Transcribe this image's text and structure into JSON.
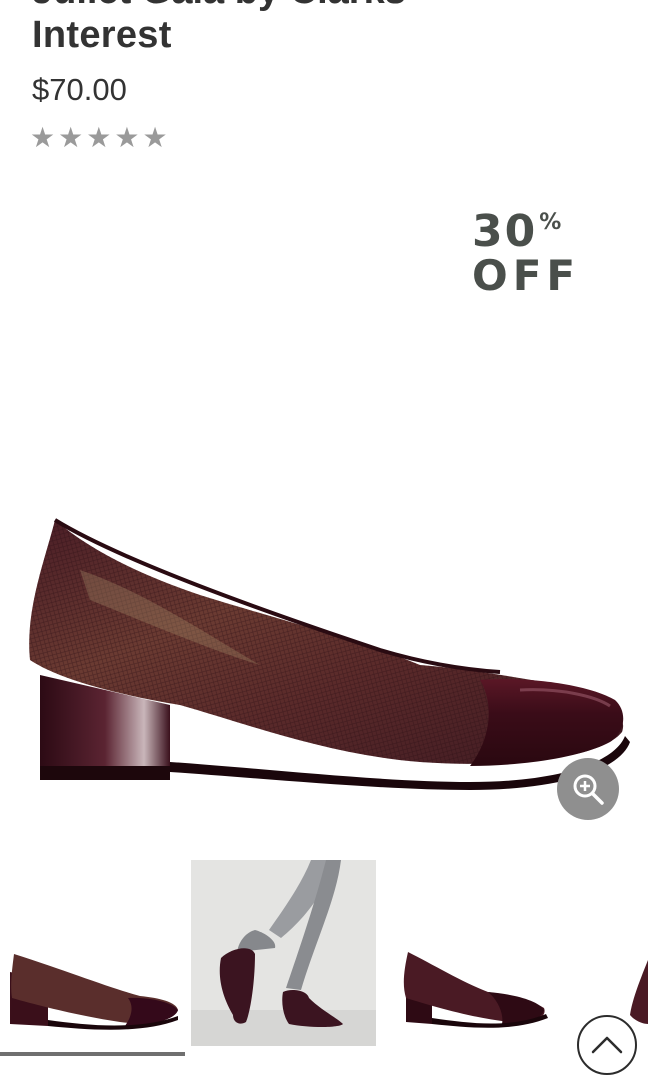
{
  "product": {
    "title_line_top": "Juliet Gala by Clarks",
    "title_line": "Interest",
    "price": "$70.00",
    "rating_stars": 5,
    "rating_filled": 0
  },
  "promo": {
    "percent": "30",
    "percent_sign": "%",
    "off": "OFF"
  },
  "gallery": {
    "selected_index": 0,
    "thumbnail_count": 4
  },
  "icons": {
    "zoom": "zoom-in-icon",
    "scroll_top": "chevron-up-icon",
    "star": "star-icon"
  },
  "colors": {
    "text": "#333333",
    "star": "#9a9a9a",
    "zoom_button": "#8f8f8f",
    "shoe_burgundy": "#4a1a22"
  }
}
